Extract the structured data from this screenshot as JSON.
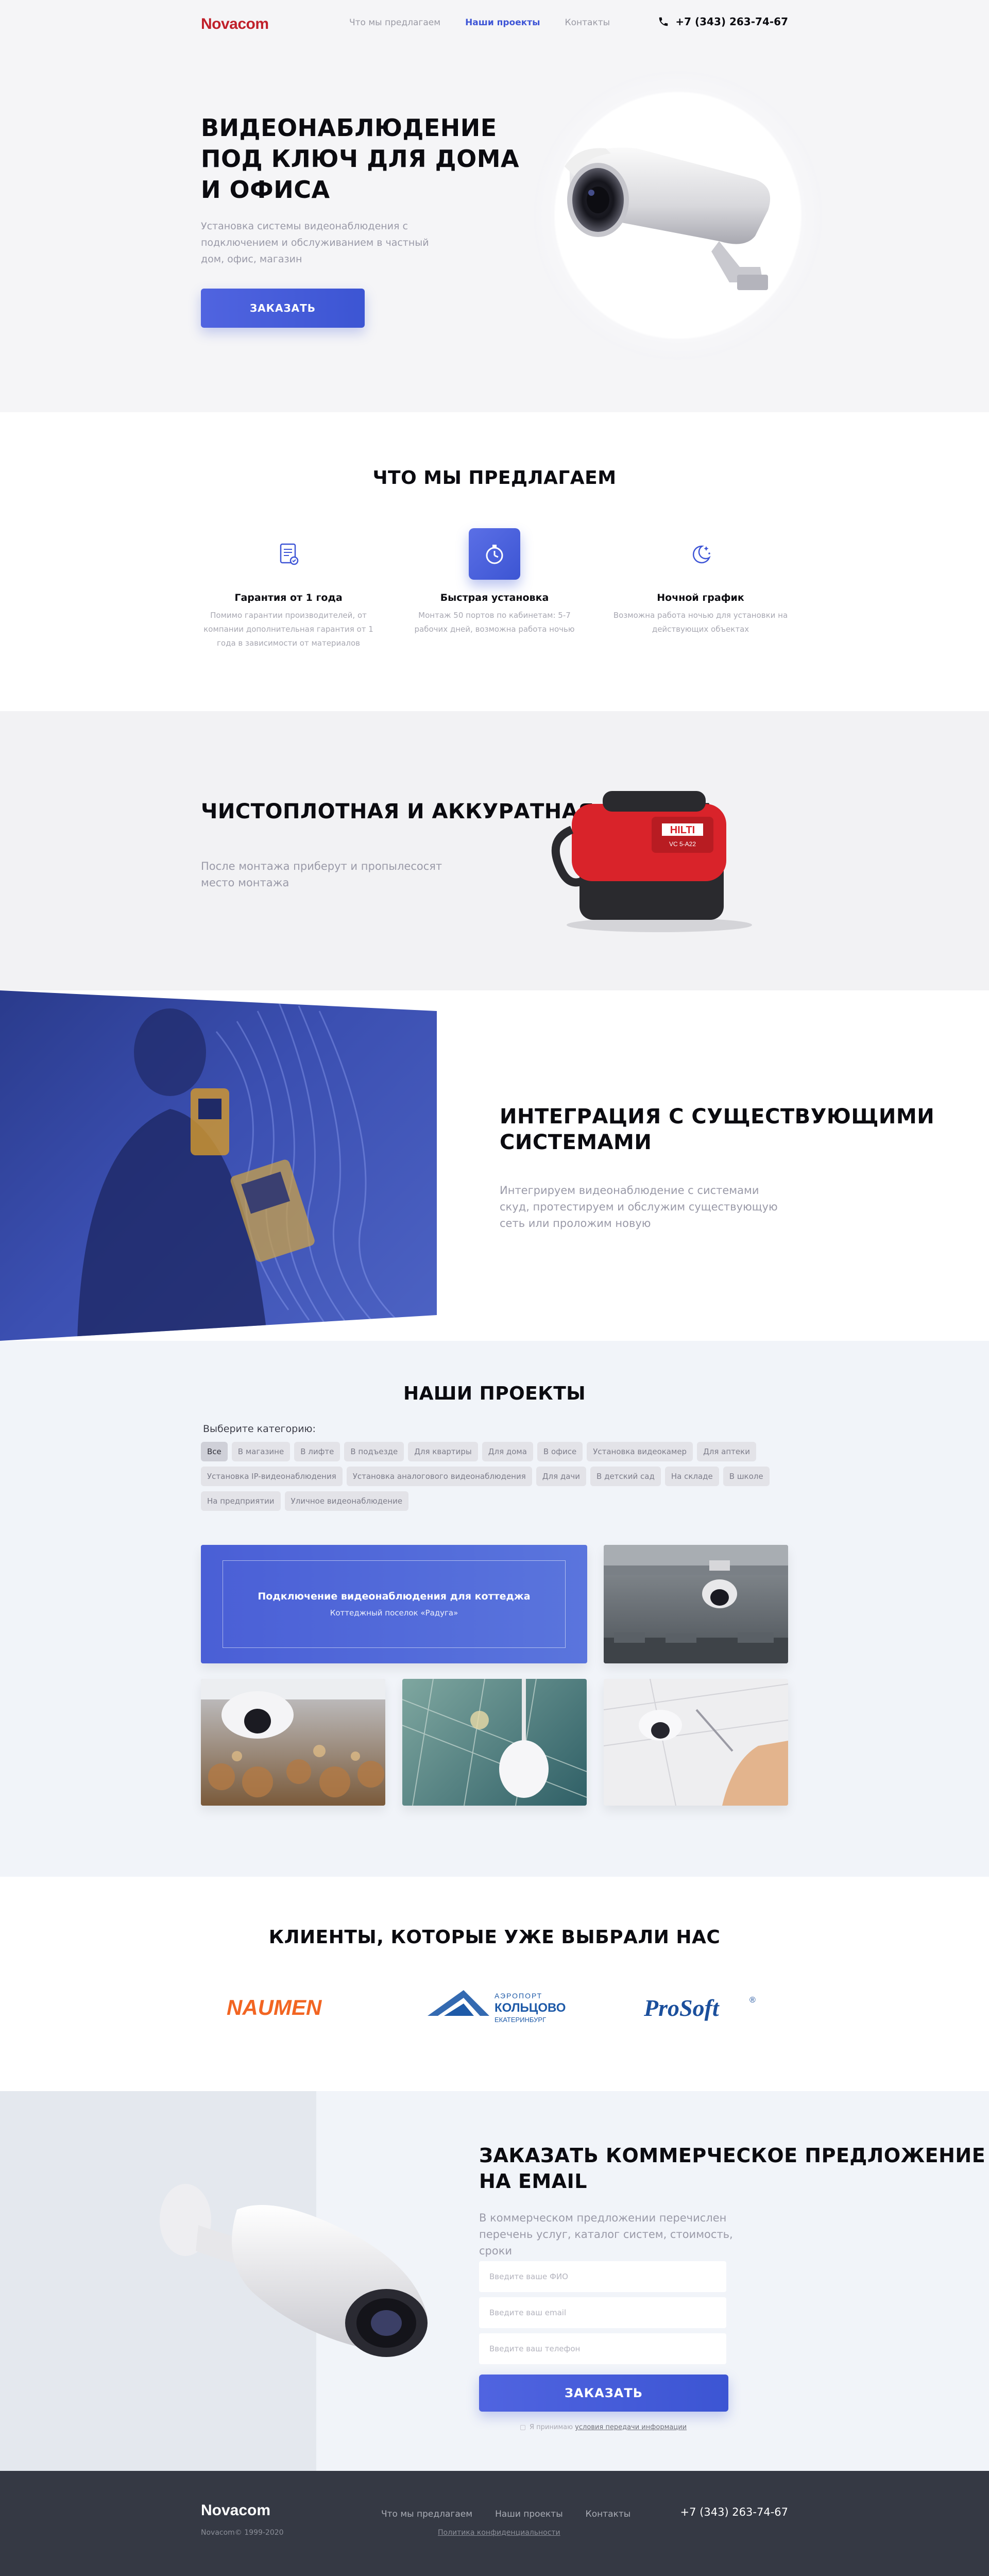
{
  "header": {
    "logo": "Novacom",
    "nav": [
      "Что мы предлагаем",
      "Наши проекты",
      "Контакты"
    ],
    "active_nav": "Наши проекты",
    "phone": "+7 (343) 263-74-67"
  },
  "hero": {
    "title": "Видеонаблюдение под ключ для дома и офиса",
    "lead": "Установка системы видеонаблюдения с подключением и обслуживанием в частный дом, офис, магазин",
    "button": "ЗАКАЗАТЬ"
  },
  "offers": {
    "title": "Что мы предлагаем",
    "items": [
      {
        "title": "Гарантия от 1 года",
        "text": "Помимо гарантии производителей, от компании дополнительная гарантия от 1 года в зависимости от материалов",
        "icon": "document-check-icon"
      },
      {
        "title": "Быстрая установка",
        "text": "Монтаж 50 портов по кабинетам: 5-7 рабочих дней, возможна работа ночью",
        "icon": "stopwatch-icon"
      },
      {
        "title": "Ночной график",
        "text": "Возможна работа ночью для установки на действующих объектах",
        "icon": "moon-stars-icon"
      }
    ]
  },
  "brigade": {
    "title": "Чистоплотная и аккуратная бригада",
    "lead": "После монтажа приберут и пропылесосят место монтажа",
    "vacuum_brand": "HILTI",
    "vacuum_model": "VC 5-A22"
  },
  "integration": {
    "title": "Интеграция с существующими системами",
    "lead": "Интегрируем видеонаблюдение с системами скуд, протестируем и обслужим существующую сеть или проложим новую"
  },
  "projects": {
    "title": "Наши проекты",
    "category_label": "Выберите категорию:",
    "categories": [
      "Все",
      "В магазине",
      "В лифте",
      "В подъезде",
      "Для квартиры",
      "Для дома",
      "В офисе",
      "Установка видеокамер",
      "Для аптеки",
      "Установка IP-видеонаблюдения",
      "Установка аналогового видеонаблюдения",
      "Для дачи",
      "В детский сад",
      "На складе",
      "В школе",
      "На предприятии",
      "Уличное видеонаблюдение"
    ],
    "active_category": "Все",
    "featured": {
      "title": "Подключение видеонаблюдения для коттеджа",
      "subtitle": "Коттеджный поселок «Радуга»"
    }
  },
  "clients": {
    "title": "Клиенты, которые уже выбрали нас",
    "logos": [
      {
        "name": "NAUMEN",
        "color": "#f26522"
      },
      {
        "name": "Аэропорт Кольцово Екатеринбург",
        "line1": "АЭРОПОРТ",
        "line2": "КОЛЬЦОВО",
        "line3": "ЕКАТЕРИНБУРГ",
        "color": "#1e5aa8"
      },
      {
        "name": "ProSoft",
        "text": "ProSoft",
        "mark": "®",
        "color": "#1b4f9c"
      }
    ]
  },
  "order": {
    "title": "Заказать коммерческое предложение на email",
    "lead": "В коммерческом предложении перечислен перечень услуг, каталог систем, стоимость, сроки",
    "fields": [
      "Введите ваше ФИО",
      "Введите ваш email",
      "Введите ваш телефон"
    ],
    "button": "ЗАКАЗАТЬ",
    "agree_text": "Я принимаю ",
    "agree_link": "условия передачи информации"
  },
  "footer": {
    "logo": "Novacom",
    "copyright": "Novacom© 1999-2020",
    "nav": [
      "Что мы предлагаем",
      "Наши проекты",
      "Контакты"
    ],
    "policy": "Политика конфиденциальности",
    "phone": "+7 (343) 263-74-67"
  },
  "colors": {
    "accent": "#3e55d6",
    "logo": "#c0202a",
    "footer": "#353944"
  }
}
